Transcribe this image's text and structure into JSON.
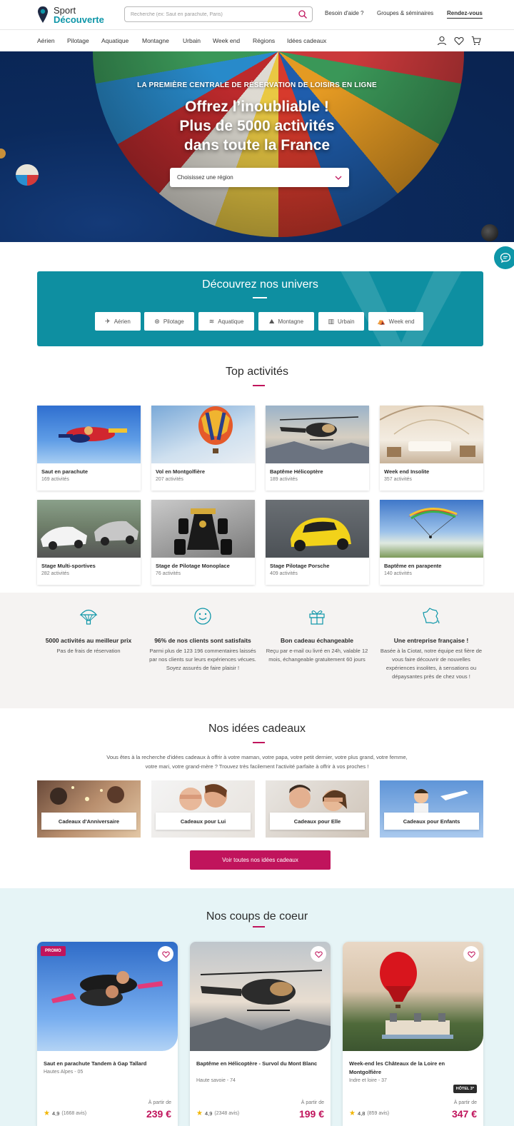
{
  "header": {
    "logo_line1": "Sport",
    "logo_line2": "Découverte",
    "search_placeholder": "Recherche (ex: Saut en parachute, Paris)",
    "help": "Besoin d'aide ?",
    "groups": "Groupes & séminaires",
    "rdv": "Rendez-vous"
  },
  "nav": {
    "items": [
      "Aérien",
      "Pilotage",
      "Aquatique",
      "Montagne",
      "Urbain",
      "Week end",
      "Régions",
      "Idées cadeaux"
    ],
    "icons": [
      "user-icon",
      "heart-icon",
      "cart-icon"
    ]
  },
  "hero": {
    "kicker": "LA PREMIÈRE CENTRALE DE RÉSERVATION DE LOISIRS EN LIGNE",
    "title_line1": "Offrez l’inoubliable !",
    "title_line2": "Plus de 5000 activités",
    "title_line3": "dans toute la France",
    "region_placeholder": "Choisissez une région"
  },
  "univers": {
    "title": "Découvrez nos univers",
    "buttons": [
      {
        "label": "Aérien",
        "icon": "plane-icon"
      },
      {
        "label": "Pilotage",
        "icon": "wheel-icon"
      },
      {
        "label": "Aquatique",
        "icon": "wave-icon"
      },
      {
        "label": "Montagne",
        "icon": "mountain-icon"
      },
      {
        "label": "Urbain",
        "icon": "building-icon"
      },
      {
        "label": "Week end",
        "icon": "tent-icon"
      }
    ]
  },
  "top": {
    "title": "Top activités",
    "cards": [
      {
        "name": "Saut en parachute",
        "count": "169 activités"
      },
      {
        "name": "Vol en Montgolfière",
        "count": "207 activités"
      },
      {
        "name": "Baptême Hélicoptère",
        "count": "189 activités"
      },
      {
        "name": "Week end Insolite",
        "count": "357 activités"
      },
      {
        "name": "Stage Multi-sportives",
        "count": "282 activités"
      },
      {
        "name": "Stage de Pilotage Monoplace",
        "count": "76 activités"
      },
      {
        "name": "Stage Pilotage Porsche",
        "count": "409 activités"
      },
      {
        "name": "Baptême en parapente",
        "count": "140 activités"
      }
    ]
  },
  "features": [
    {
      "icon": "parachute-icon",
      "title": "5000 activités au meilleur prix",
      "desc": "Pas de frais de réservation"
    },
    {
      "icon": "smiley-icon",
      "title": "96% de nos clients sont satisfaits",
      "desc": "Parmi plus de 123 196 commentaires laissés par nos clients sur leurs expériences vécues. Soyez assurés de faire plaisir !"
    },
    {
      "icon": "gift-icon",
      "title": "Bon cadeau échangeable",
      "desc": "Reçu par e-mail ou livré en 24h, valable 12 mois, échangeable gratuitement 60 jours"
    },
    {
      "icon": "france-map-icon",
      "title": "Une entreprise française !",
      "desc": "Basée à la Ciotat, notre équipe est fière de vous faire découvrir de nouvelles expériences insolites, à sensations ou dépaysantes près de chez vous !"
    }
  ],
  "gifts": {
    "title": "Nos idées cadeaux",
    "intro": "Vous êtes à la recherche d'idées cadeaux à offrir à votre maman, votre papa, votre petit dernier, votre plus grand, votre femme, votre mari, votre grand-mère ? Trouvez très facilement l'activité parfaite à offrir à vos proches !",
    "cards": [
      "Cadeaux d'Anniversaire",
      "Cadeaux pour Lui",
      "Cadeaux pour Elle",
      "Cadeaux pour Enfants"
    ],
    "cta": "Voir toutes nos idées cadeaux"
  },
  "favs": {
    "title": "Nos coups de coeur",
    "cards": [
      {
        "promo": "PROMO",
        "name": "Saut en parachute Tandem à Gap Tallard",
        "loc": "Hautes Alpes - 05",
        "rating": "4,9",
        "reviews": "(1668 avis)",
        "from": "À partir de",
        "price": "239 €"
      },
      {
        "name": "Baptême en Hélicoptère - Survol du Mont Blanc",
        "loc": "Haute savoie - 74",
        "rating": "4,9",
        "reviews": "(2348 avis)",
        "from": "À partir de",
        "price": "199 €"
      },
      {
        "name": "Week-end les Châteaux de la Loire en Montgolfière",
        "loc": "Indre et loire - 37",
        "badge": "HÔTEL 3*",
        "rating": "4,8",
        "reviews": "(859 avis)",
        "from": "À partir de",
        "price": "347 €"
      }
    ]
  },
  "colors": {
    "brand": "#0e96a8",
    "accent": "#c0145c",
    "star": "#f2b600"
  }
}
